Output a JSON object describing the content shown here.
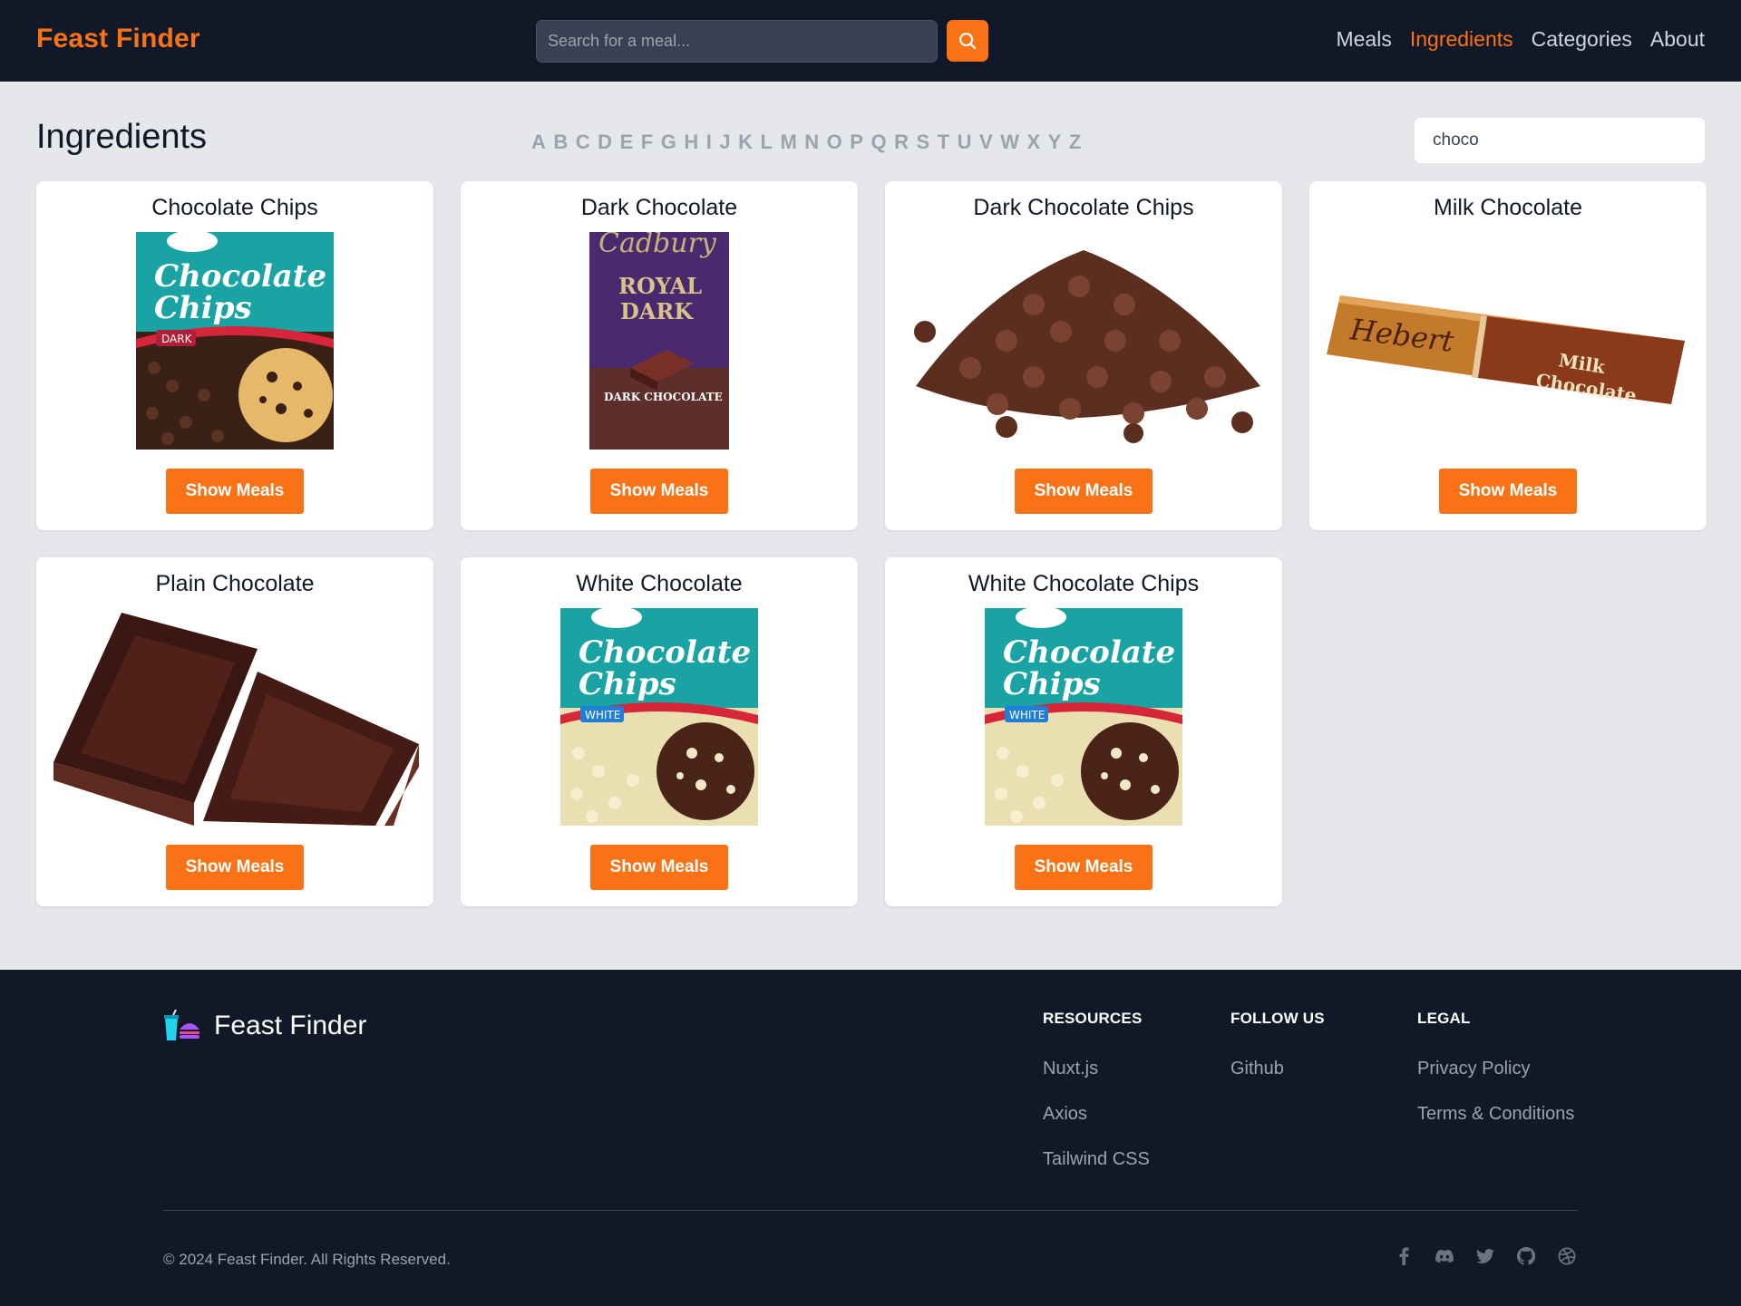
{
  "header": {
    "logo": "Feast Finder",
    "search_placeholder": "Search for a meal...",
    "nav": [
      {
        "label": "Meals",
        "active": false
      },
      {
        "label": "Ingredients",
        "active": true
      },
      {
        "label": "Categories",
        "active": false
      },
      {
        "label": "About",
        "active": false
      }
    ]
  },
  "main": {
    "title": "Ingredients",
    "letters": [
      "A",
      "B",
      "C",
      "D",
      "E",
      "F",
      "G",
      "H",
      "I",
      "J",
      "K",
      "L",
      "M",
      "N",
      "O",
      "P",
      "Q",
      "R",
      "S",
      "T",
      "U",
      "V",
      "W",
      "X",
      "Y",
      "Z"
    ],
    "filter_value": "choco",
    "button_label": "Show Meals",
    "ingredients": [
      {
        "name": "Chocolate Chips",
        "image": "chocolate-chips-package-dark"
      },
      {
        "name": "Dark Chocolate",
        "image": "royal-dark-chocolate-bar"
      },
      {
        "name": "Dark Chocolate Chips",
        "image": "chocolate-chips-pile"
      },
      {
        "name": "Milk Chocolate",
        "image": "hebert-milk-chocolate-bar"
      },
      {
        "name": "Plain Chocolate",
        "image": "chocolate-squares"
      },
      {
        "name": "White Chocolate",
        "image": "chocolate-chips-package-white"
      },
      {
        "name": "White Chocolate Chips",
        "image": "chocolate-chips-package-white"
      }
    ]
  },
  "footer": {
    "brand": "Feast Finder",
    "columns": [
      {
        "heading": "RESOURCES",
        "links": [
          "Nuxt.js",
          "Axios",
          "Tailwind CSS"
        ]
      },
      {
        "heading": "FOLLOW US",
        "links": [
          "Github"
        ]
      },
      {
        "heading": "LEGAL",
        "links": [
          "Privacy Policy",
          "Terms & Conditions"
        ]
      }
    ],
    "copyright": "© 2024 Feast Finder. All Rights Reserved.",
    "social": [
      "facebook-icon",
      "discord-icon",
      "twitter-icon",
      "github-icon",
      "dribbble-icon"
    ]
  },
  "colors": {
    "accent": "#f97316",
    "dark": "#111827",
    "page_bg": "#e5e7eb"
  }
}
